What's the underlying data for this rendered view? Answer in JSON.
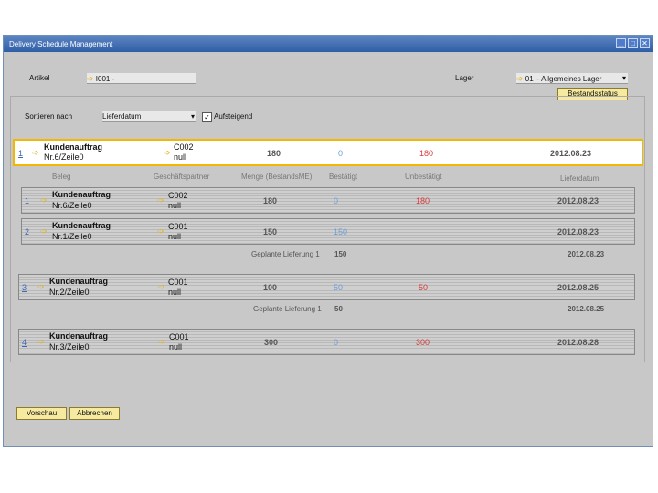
{
  "window": {
    "title": "Delivery Schedule Management",
    "controls": [
      "▁",
      "□",
      "✕"
    ]
  },
  "form": {
    "artikel_label": "Artikel",
    "artikel_value": "I001 -",
    "lager_label": "Lager",
    "lager_value": "01 – Allgemeines Lager",
    "bestandsstatus_label": "Bestandsstatus",
    "sortieren_label": "Sortieren nach",
    "sortieren_value": "Lieferdatum",
    "aufsteigend_label": "Aufsteigend"
  },
  "columns": [
    "Beleg",
    "Geschäftspartner",
    "Menge (BestandsME)",
    "Bestätigt",
    "Unbestätigt",
    "Lieferdatum"
  ],
  "selected": {
    "num": "1",
    "doc": "Kundenauftrag",
    "ref": "Nr.6/Zeile0",
    "bp": "C002",
    "bp2": "null",
    "menge": "180",
    "bestaetigt": "0",
    "unbestaetigt": "180",
    "datum": "2012.08.23"
  },
  "rows": [
    {
      "num": "1",
      "doc": "Kundenauftrag",
      "ref": "Nr.6/Zeile0",
      "bp": "C002",
      "bp2": "null",
      "menge": "180",
      "bestaetigt": "0",
      "unbestaetigt": "180",
      "datum": "2012.08.23"
    },
    {
      "num": "2",
      "doc": "Kundenauftrag",
      "ref": "Nr.1/Zeile0",
      "bp": "C001",
      "bp2": "null",
      "menge": "150",
      "bestaetigt": "150",
      "unbestaetigt": "",
      "datum": "2012.08.23"
    },
    {
      "num": "3",
      "doc": "Kundenauftrag",
      "ref": "Nr.2/Zeile0",
      "bp": "C001",
      "bp2": "null",
      "menge": "100",
      "bestaetigt": "50",
      "unbestaetigt": "50",
      "datum": "2012.08.25"
    },
    {
      "num": "4",
      "doc": "Kundenauftrag",
      "ref": "Nr.3/Zeile0",
      "bp": "C001",
      "bp2": "null",
      "menge": "300",
      "bestaetigt": "0",
      "unbestaetigt": "300",
      "datum": "2012.08.28"
    }
  ],
  "planned": [
    {
      "label": "Geplante Lieferung 1",
      "menge": "150",
      "datum": "2012.08.23"
    },
    {
      "label": "Geplante Lieferung 1",
      "menge": "50",
      "datum": "2012.08.25"
    }
  ],
  "buttons": {
    "vorschau": "Vorschau",
    "abbrechen": "Abbrechen"
  }
}
